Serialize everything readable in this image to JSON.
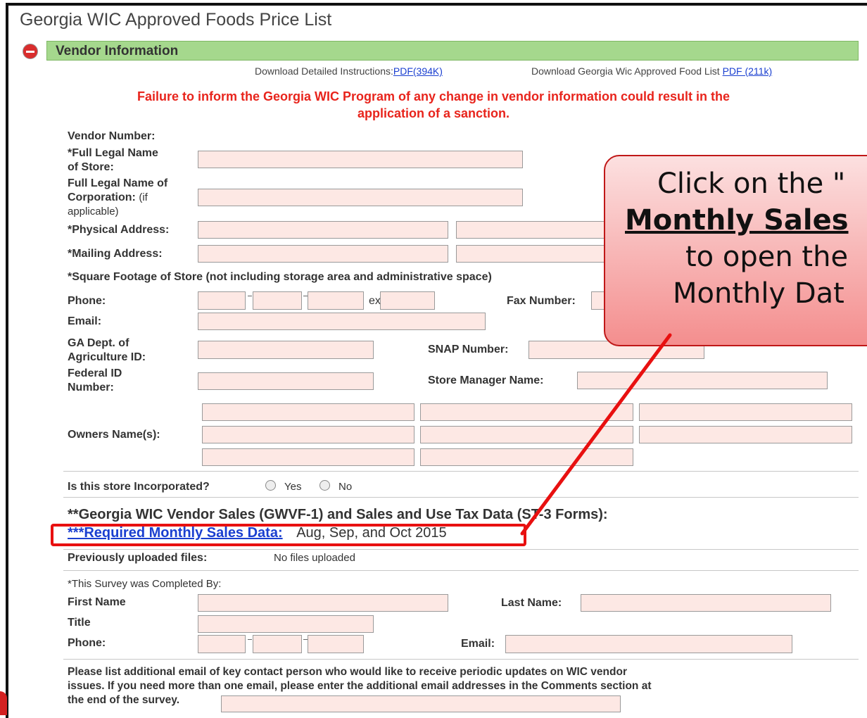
{
  "page": {
    "title": "Georgia WIC Approved Foods Price List"
  },
  "section": {
    "title": "Vendor Information"
  },
  "downloads": {
    "instructions_label": "Download Detailed Instructions:",
    "instructions_link": "PDF(394K)",
    "food_list_label": "Download Georgia Wic Approved Food List",
    "food_list_link": "PDF (211k)"
  },
  "warning": {
    "line1": "Failure to inform the Georgia WIC Program of any change in vendor information could result in the",
    "line2": "application of a sanction."
  },
  "form": {
    "vendor_number": "Vendor Number:",
    "legal_name_1": "*Full Legal Name",
    "legal_name_2": "of Store:",
    "corp_1": "Full Legal Name of",
    "corp_2": "Corporation:",
    "corp_if": "(if",
    "corp_3": "applicable)",
    "physical": "*Physical Address:",
    "mailing": "*Mailing Address:",
    "sqft": "*Square Footage of Store (not including storage area and administrative space)",
    "phone": "Phone:",
    "ext": "ext.",
    "fax": "Fax Number:",
    "email": "Email:",
    "ga_ag_1": "GA Dept. of",
    "ga_ag_2": "Agriculture ID:",
    "snap": "SNAP Number:",
    "fed_1": "Federal ID",
    "fed_2": "Number:",
    "manager": "Store Manager Name:",
    "owners": "Owners Name(s):",
    "incorporated": "Is this store Incorporated?",
    "yes": "Yes",
    "no": "No",
    "gwvf": "**Georgia WIC Vendor Sales (GWVF-1) and Sales and Use Tax Data (ST-3 Forms):",
    "required_link": "***Required Monthly Sales Data:",
    "required_months": "Aug, Sep, and Oct 2015",
    "prev_uploaded": "Previously uploaded files:",
    "no_files": "No files uploaded",
    "survey_by": "*This Survey was Completed By:",
    "first_name": "First Name",
    "last_name": "Last Name:",
    "title": "Title",
    "phone2": "Phone:",
    "email2": "Email:",
    "additional_1": "Please list additional email of key contact person who would like to receive periodic updates on WIC vendor",
    "additional_2": "issues. If you need more than one email, please enter the additional email addresses in the Comments section at",
    "additional_3": "the end of the survey."
  },
  "callout": {
    "line1": "Click on the \"",
    "line2": "Monthly Sales",
    "line3": "to open the",
    "line4": "Monthly Dat"
  },
  "colors": {
    "accent_bar": "#a5d88d",
    "warning": "#e8241c",
    "link": "#1a3fd0",
    "input_bg": "#fde8e4",
    "highlight": "#e81010"
  }
}
